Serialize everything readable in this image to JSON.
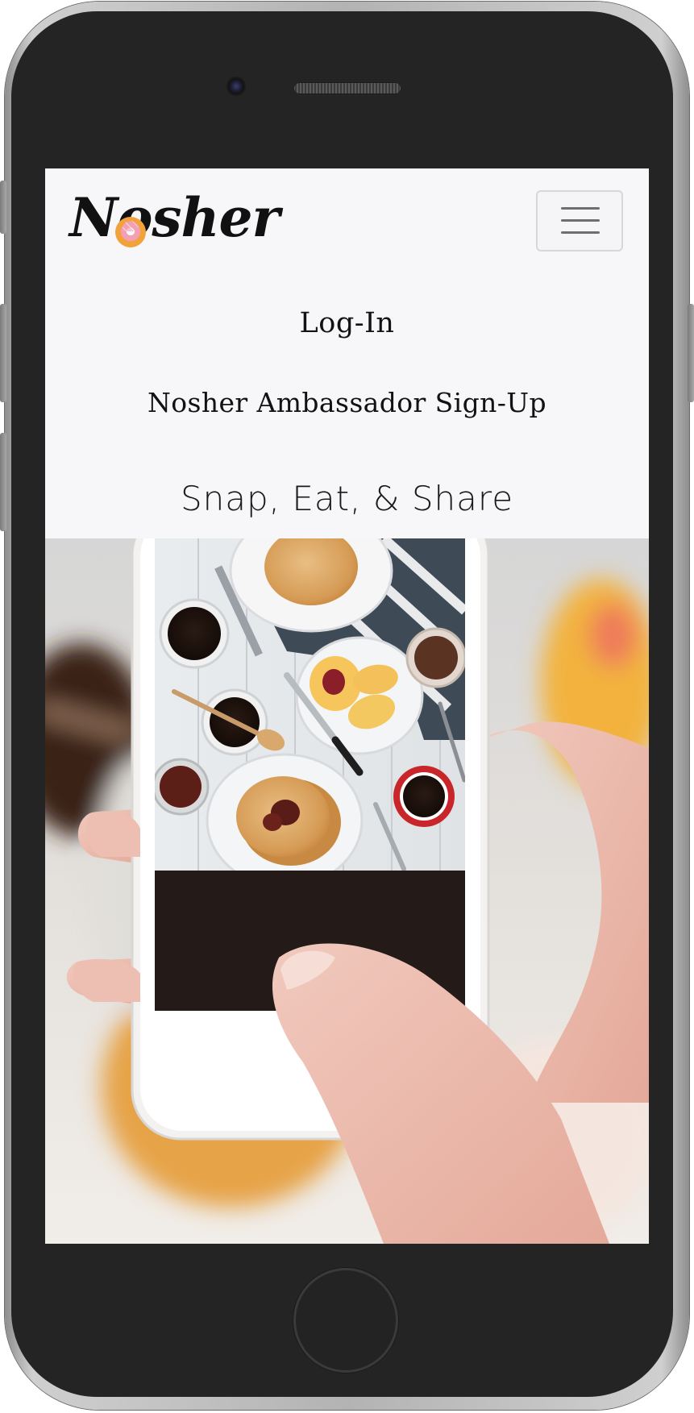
{
  "app": {
    "brand_name": "Nosher"
  },
  "nav": {
    "menu_icon": "hamburger-icon",
    "links": [
      {
        "label": "Log-In"
      },
      {
        "label": "Nosher Ambassador Sign-Up"
      }
    ]
  },
  "hero": {
    "tagline": "Snap, Eat, & Share",
    "image_description_icon": "phone-photo-food"
  },
  "colors": {
    "screen_background": "#f7f7f9",
    "text": "#121212",
    "phone_body": "#242424",
    "donut_icing": "#f3a0b4",
    "donut_dough": "#f2a23a"
  }
}
